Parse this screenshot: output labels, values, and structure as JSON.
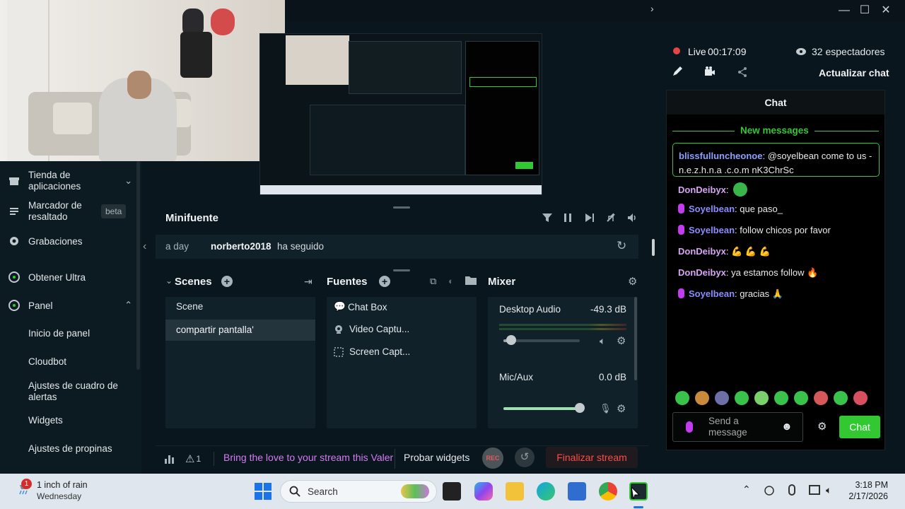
{
  "window": {
    "controls": {
      "minimize": "—",
      "maximize": "☐",
      "close": "✕"
    }
  },
  "sidebar": {
    "items": [
      {
        "label": "Tienda de aplicaciones",
        "icon": "store-icon"
      },
      {
        "label": "Marcador de resaltado",
        "badge": "beta",
        "icon": "highlighter-icon"
      },
      {
        "label": "Grabaciones",
        "icon": "record-icon"
      },
      {
        "label": "Obtener Ultra",
        "icon": "ultra-icon"
      },
      {
        "label": "Panel",
        "icon": "dashboard-icon"
      }
    ],
    "subitems": [
      "Inicio de panel",
      "Cloudbot",
      "Ajustes de cuadro de alertas",
      "Widgets",
      "Ajustes de propinas"
    ]
  },
  "minifeed": {
    "title": "Minifuente",
    "event": {
      "time": "a day",
      "user": "norberto2018",
      "action": "ha seguido"
    }
  },
  "scenes": {
    "title": "Scenes",
    "items": [
      "Scene",
      "compartir pantalla'"
    ]
  },
  "sources": {
    "title": "Fuentes",
    "items": [
      "Chat Box",
      "Video Captu...",
      "Screen Capt..."
    ]
  },
  "mixer": {
    "title": "Mixer",
    "channels": [
      {
        "name": "Desktop Audio",
        "db": "-49.3 dB",
        "level": 0.1
      },
      {
        "name": "Mic/Aux",
        "db": "0.0 dB",
        "level": 1.0
      }
    ]
  },
  "footer": {
    "alert_count": "1",
    "promo": "Bring the love to your stream this Valer",
    "test_widgets": "Probar widgets",
    "rec": "REC",
    "end_stream": "Finalizar stream"
  },
  "stream": {
    "status": "Live",
    "timer": "00:17:09",
    "viewers": "32 espectadores",
    "refresh_chat": "Actualizar chat"
  },
  "chat": {
    "title": "Chat",
    "new_messages": "New messages",
    "highlight": {
      "user": "blissfullunchеonoe",
      "text": ": @soyelbean come to us - n.e.z.h.n.a .c.o.m nK3ChrSc"
    },
    "messages": [
      {
        "user": "DonDeibyx",
        "text": ":",
        "type": "v",
        "mic": false
      },
      {
        "user": "Soyelbean",
        "text": ": que paso_",
        "type": "b",
        "mic": true
      },
      {
        "user": "Soyelbean",
        "text": ": follow chicos por favor",
        "type": "b",
        "mic": true
      },
      {
        "user": "DonDeibyx",
        "text": ": 💪 💪 💪",
        "type": "v",
        "mic": false
      },
      {
        "user": "DonDeibyx",
        "text": ": ya estamos follow 🔥",
        "type": "v",
        "mic": false
      },
      {
        "user": "Soyelbean",
        "text": ": gracias 🙏",
        "type": "b",
        "mic": true
      }
    ],
    "input_placeholder": "Send a message",
    "send": "Chat"
  },
  "taskbar": {
    "weather_badge": "1",
    "weather": "1 inch of rain",
    "weather_day": "Wednesday",
    "search": "Search",
    "time": "3:18 PM",
    "date": "2/17/2026"
  },
  "colors": {
    "accent_green": "#31c831",
    "end_red": "#ff4b4b",
    "live_red": "#e64545",
    "bg": "#09161d"
  }
}
